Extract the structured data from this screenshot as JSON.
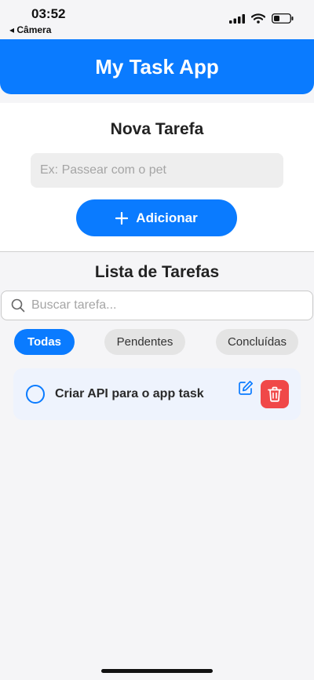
{
  "status_bar": {
    "time": "03:52",
    "back_label": "◂ Câmera",
    "icons": [
      "cellular-signal-icon",
      "wifi-icon",
      "battery-icon"
    ]
  },
  "header": {
    "title": "My Task App"
  },
  "new_task": {
    "title": "Nova Tarefa",
    "input_placeholder": "Ex: Passear com o pet",
    "input_value": "",
    "add_button_label": "Adicionar",
    "add_icon": "plus-icon"
  },
  "task_list": {
    "title": "Lista de Tarefas",
    "search_placeholder": "Buscar tarefa...",
    "search_icon": "search-icon",
    "filters": [
      {
        "label": "Todas",
        "active": true
      },
      {
        "label": "Pendentes",
        "active": false
      },
      {
        "label": "Concluídas",
        "active": false
      }
    ],
    "tasks": [
      {
        "text": "Criar API para o app task",
        "completed": false
      }
    ]
  },
  "colors": {
    "accent": "#0a7bff",
    "danger": "#f04848",
    "card_bg": "#eef3fd",
    "page_bg": "#f5f5f7"
  }
}
